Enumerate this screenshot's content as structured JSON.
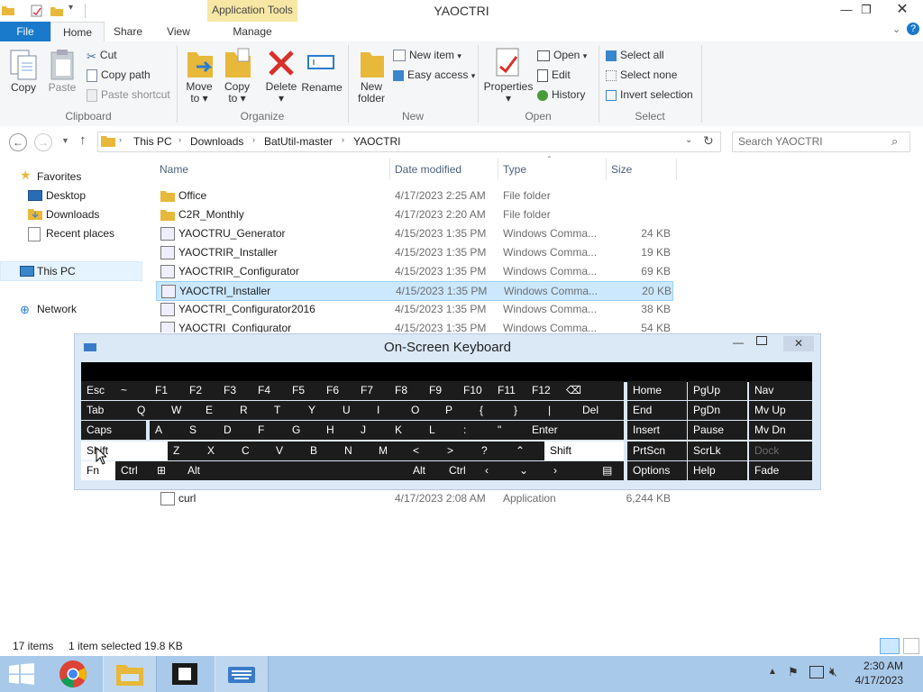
{
  "window": {
    "title": "YAOCTRI",
    "context_tab": "Application Tools"
  },
  "tabs": [
    "File",
    "Home",
    "Share",
    "View",
    "Manage"
  ],
  "ribbon": {
    "clipboard": {
      "copy": "Copy",
      "paste": "Paste",
      "cut": "Cut",
      "copy_path": "Copy path",
      "paste_shortcut": "Paste shortcut",
      "group": "Clipboard"
    },
    "organize": {
      "move_to": "Move",
      "move_to_2": "to",
      "copy_to": "Copy",
      "copy_to_2": "to",
      "delete": "Delete",
      "rename": "Rename",
      "group": "Organize"
    },
    "new": {
      "new_folder": "New",
      "new_folder_2": "folder",
      "new_item": "New item",
      "easy_access": "Easy access",
      "group": "New"
    },
    "open": {
      "properties": "Properties",
      "open": "Open",
      "edit": "Edit",
      "history": "History",
      "group": "Open"
    },
    "select": {
      "select_all": "Select all",
      "select_none": "Select none",
      "invert_selection": "Invert selection",
      "group": "Select"
    }
  },
  "address": {
    "crumbs": [
      "This PC",
      "Downloads",
      "BatUtil-master",
      "YAOCTRI"
    ],
    "search_placeholder": "Search YAOCTRI"
  },
  "nav_pane": {
    "favorites": "Favorites",
    "desktop": "Desktop",
    "downloads": "Downloads",
    "recent": "Recent places",
    "this_pc": "This PC",
    "network": "Network"
  },
  "columns": {
    "name": "Name",
    "date": "Date modified",
    "type": "Type",
    "size": "Size"
  },
  "files": [
    {
      "name": "Office",
      "date": "4/17/2023 2:25 AM",
      "type": "File folder",
      "size": "",
      "icon": "folder"
    },
    {
      "name": "C2R_Monthly",
      "date": "4/17/2023 2:20 AM",
      "type": "File folder",
      "size": "",
      "icon": "folder"
    },
    {
      "name": "YAOCTRU_Generator",
      "date": "4/15/2023 1:35 PM",
      "type": "Windows Comma...",
      "size": "24 KB",
      "icon": "script"
    },
    {
      "name": "YAOCTRIR_Installer",
      "date": "4/15/2023 1:35 PM",
      "type": "Windows Comma...",
      "size": "19 KB",
      "icon": "script"
    },
    {
      "name": "YAOCTRIR_Configurator",
      "date": "4/15/2023 1:35 PM",
      "type": "Windows Comma...",
      "size": "69 KB",
      "icon": "script"
    },
    {
      "name": "YAOCTRI_Installer",
      "date": "4/15/2023 1:35 PM",
      "type": "Windows Comma...",
      "size": "20 KB",
      "icon": "script",
      "selected": true
    },
    {
      "name": "YAOCTRI_Configurator2016",
      "date": "4/15/2023 1:35 PM",
      "type": "Windows Comma...",
      "size": "38 KB",
      "icon": "script"
    },
    {
      "name": "YAOCTRI_Configurator",
      "date": "4/15/2023 1:35 PM",
      "type": "Windows Comma...",
      "size": "54 KB",
      "icon": "script"
    }
  ],
  "file_bottom": {
    "name": "curl",
    "date": "4/17/2023 2:08 AM",
    "type": "Application",
    "size": "6,244 KB",
    "icon": "app"
  },
  "status": {
    "items": "17 items",
    "selected": "1 item selected  19.8 KB"
  },
  "osk": {
    "title": "On-Screen Keyboard",
    "row1": [
      "Esc",
      "~",
      "F1",
      "F2",
      "F3",
      "F4",
      "F5",
      "F6",
      "F7",
      "F8",
      "F9",
      "F10",
      "F11",
      "F12"
    ],
    "row2": [
      "Tab",
      "Q",
      "W",
      "E",
      "R",
      "T",
      "Y",
      "U",
      "I",
      "O",
      "P",
      "{",
      "}",
      "|",
      "Del"
    ],
    "row3": [
      "Caps",
      "A",
      "S",
      "D",
      "F",
      "G",
      "H",
      "J",
      "K",
      "L",
      ":",
      "\"",
      "Enter"
    ],
    "row4": [
      "Shift",
      "Z",
      "X",
      "C",
      "V",
      "B",
      "N",
      "M",
      "<",
      ">",
      "?",
      "Shift"
    ],
    "row5": [
      "Fn",
      "Ctrl",
      "Alt",
      "Alt",
      "Ctrl"
    ],
    "nav1": [
      "Home",
      "PgUp",
      "Nav"
    ],
    "nav2": [
      "End",
      "PgDn",
      "Mv Up"
    ],
    "nav3": [
      "Insert",
      "Pause",
      "Mv Dn"
    ],
    "nav4": [
      "PrtScn",
      "ScrLk",
      "Dock"
    ],
    "nav5": [
      "Options",
      "Help",
      "Fade"
    ]
  },
  "clock": {
    "time": "2:30 AM",
    "date": "4/17/2023"
  }
}
